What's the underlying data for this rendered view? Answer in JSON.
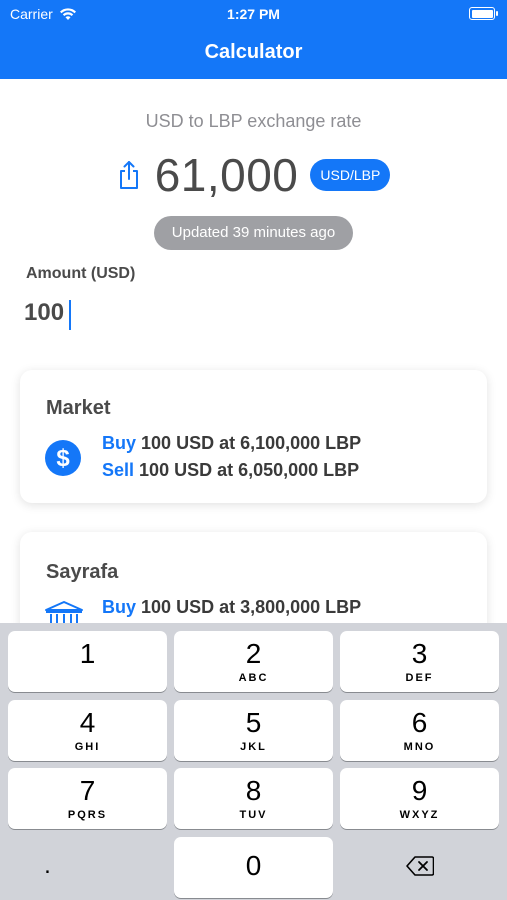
{
  "status": {
    "carrier": "Carrier",
    "time": "1:27 PM",
    "battery_level": 1.0
  },
  "nav": {
    "title": "Calculator"
  },
  "rate": {
    "caption": "USD to LBP exchange rate",
    "value": "61,000",
    "pair": "USD/LBP",
    "updated": "Updated 39 minutes ago"
  },
  "amount": {
    "label": "Amount (USD)",
    "value": "100"
  },
  "cards": {
    "market": {
      "title": "Market",
      "buy_verb": "Buy",
      "buy_text": "100 USD at 6,100,000 LBP",
      "sell_verb": "Sell",
      "sell_text": "100 USD at 6,050,000 LBP",
      "icon": "dollar-circle-icon"
    },
    "sayrafa": {
      "title": "Sayrafa",
      "buy_verb": "Buy",
      "buy_text": "100 USD at 3,800,000 LBP",
      "icon": "bank-icon"
    }
  },
  "keypad": {
    "keys": [
      {
        "digit": "1",
        "letters": ""
      },
      {
        "digit": "2",
        "letters": "ABC"
      },
      {
        "digit": "3",
        "letters": "DEF"
      },
      {
        "digit": "4",
        "letters": "GHI"
      },
      {
        "digit": "5",
        "letters": "JKL"
      },
      {
        "digit": "6",
        "letters": "MNO"
      },
      {
        "digit": "7",
        "letters": "PQRS"
      },
      {
        "digit": "8",
        "letters": "TUV"
      },
      {
        "digit": "9",
        "letters": "WXYZ"
      }
    ],
    "dot": ".",
    "zero": "0",
    "delete_icon": "delete-backspace-icon"
  },
  "colors": {
    "accent": "#1477f8",
    "keyboard_bg": "#d1d3d9",
    "badge_gray": "#9fa0a4"
  }
}
